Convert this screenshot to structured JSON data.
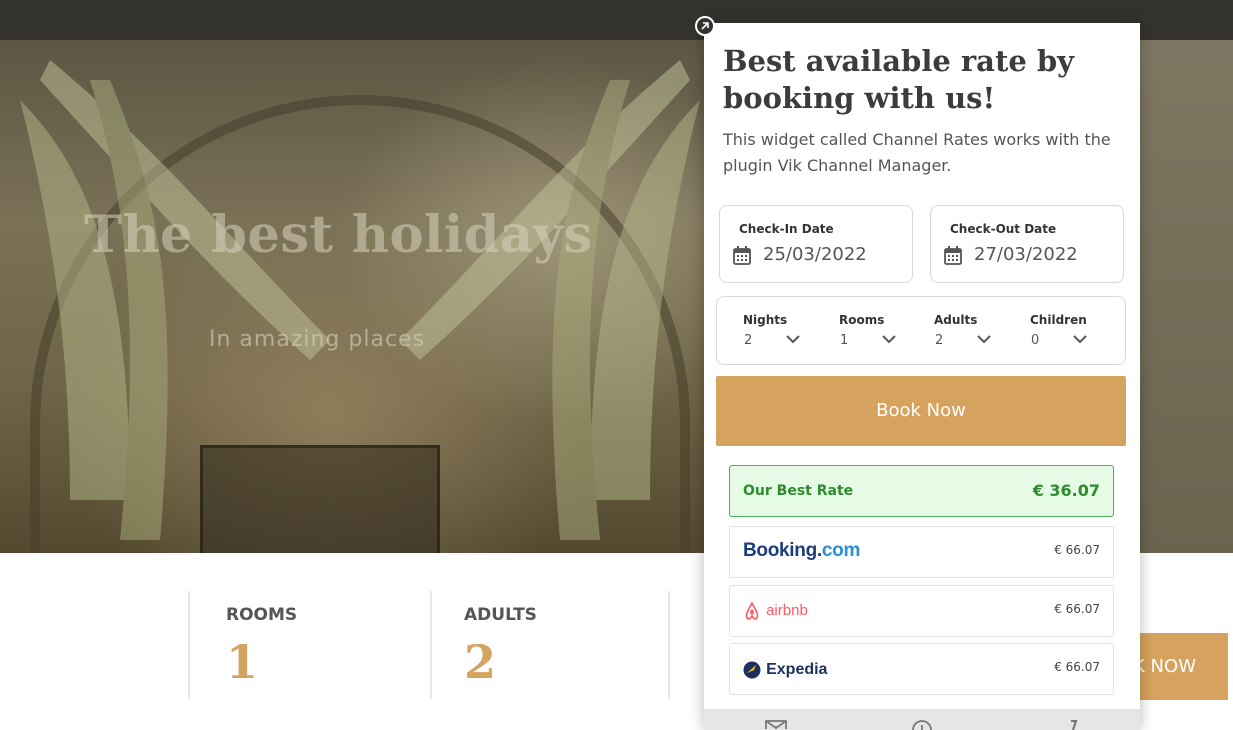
{
  "hero": {
    "title": "The best holidays",
    "subtitle": "In amazing places"
  },
  "booking_bar": {
    "rooms_label": "ROOMS",
    "rooms_value": "1",
    "adults_label": "ADULTS",
    "adults_value": "2",
    "book_label": "K NOW"
  },
  "widget": {
    "title": "Best available rate by booking with us!",
    "description": "This widget called Channel Rates works with the plugin Vik Channel Manager.",
    "checkin": {
      "label": "Check-In Date",
      "value": "25/03/2022"
    },
    "checkout": {
      "label": "Check-Out Date",
      "value": "27/03/2022"
    },
    "options": [
      {
        "label": "Nights",
        "value": "2"
      },
      {
        "label": "Rooms",
        "value": "1"
      },
      {
        "label": "Adults",
        "value": "2"
      },
      {
        "label": "Children",
        "value": "0"
      }
    ],
    "book_button": "Book Now",
    "best_rate": {
      "label": "Our Best Rate",
      "price": "€ 36.07"
    },
    "channels": [
      {
        "name": "Booking.com",
        "logo_main": "Booking",
        "logo_dot": ".",
        "logo_suffix": "com",
        "price": "€ 66.07"
      },
      {
        "name": "airbnb",
        "logo_text": "airbnb",
        "price": "€ 66.07"
      },
      {
        "name": "Expedia",
        "logo_text": "Expedia",
        "price": "€ 66.07"
      }
    ]
  },
  "colors": {
    "accent": "#d6a35e",
    "best_rate_green": "#2e8b2e",
    "booking_blue": "#1b3d7a",
    "airbnb_red": "#ff5a5f",
    "expedia_navy": "#1d2f5c"
  },
  "icons": [
    "close-icon",
    "calendar-icon",
    "chevron-down-icon",
    "airbnb-logo-icon",
    "expedia-logo-icon",
    "mail-icon",
    "clock-icon",
    "phone-icon"
  ]
}
